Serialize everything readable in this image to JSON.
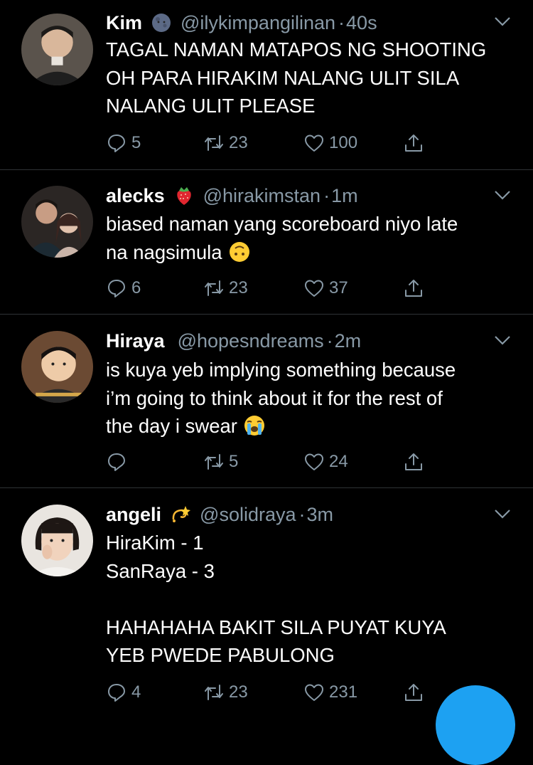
{
  "tweets": [
    {
      "name": "Kim",
      "name_emoji": "new-moon-face-emoji",
      "handle": "@ilykimpangilinan",
      "time": "40s",
      "lines": [
        "TAGAL NAMAN MATAPOS NG SHOOTING",
        "OH PARA HIRAKIM NALANG ULIT SILA",
        "NALANG ULIT PLEASE"
      ],
      "replies": "5",
      "retweets": "23",
      "likes": "100"
    },
    {
      "name": "alecks",
      "name_emoji": "strawberry-emoji",
      "handle": "@hirakimstan",
      "time": "1m",
      "lines": [
        "biased naman yang scoreboard niyo late",
        "na nagsimula"
      ],
      "inline_emoji": "upside-down-face-emoji",
      "replies": "6",
      "retweets": "23",
      "likes": "37"
    },
    {
      "name": "Hiraya",
      "handle": "@hopesndreams",
      "time": "2m",
      "lines": [
        "is kuya yeb implying something because",
        "i’m going to think about it for the rest of",
        "the day i swear"
      ],
      "inline_emoji": "loudly-crying-face-emoji",
      "replies": "",
      "retweets": "5",
      "likes": "24"
    },
    {
      "name": "angeli",
      "name_emoji": "dizzy-emoji",
      "handle": "@solidraya",
      "time": "3m",
      "lines": [
        "HiraKim - 1",
        "SanRaya - 3",
        "",
        "HAHAHAHA BAKIT SILA PUYAT KUYA",
        "YEB PWEDE PABULONG"
      ],
      "replies": "4",
      "retweets": "23",
      "likes": "231"
    }
  ],
  "dot": "·",
  "colors": {
    "background": "#000000",
    "secondary_text": "#8899a6",
    "separator": "#2f3336",
    "accent": "#1da1f2"
  }
}
